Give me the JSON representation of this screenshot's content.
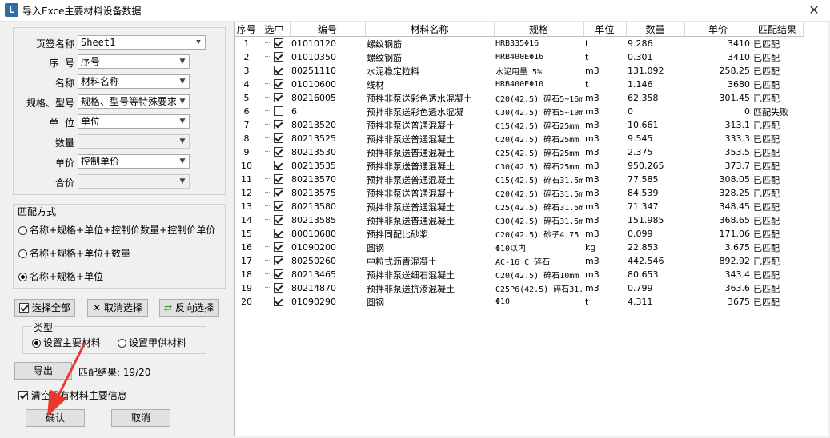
{
  "window": {
    "title": "导入Exce主要材料设备数据",
    "close_glyph": "✕"
  },
  "mapping": {
    "fields": [
      {
        "label": "页签名称",
        "value": "Sheet1",
        "enabled": true
      },
      {
        "label": "序  号",
        "value": "序号",
        "enabled": true
      },
      {
        "label": "名称",
        "value": "材料名称",
        "enabled": true
      },
      {
        "label": "规格、型号",
        "value": "规格、型号等特殊要求",
        "enabled": true
      },
      {
        "label": "单  位",
        "value": "单位",
        "enabled": true
      },
      {
        "label": "数量",
        "value": "",
        "enabled": false
      },
      {
        "label": "单价",
        "value": "控制单价",
        "enabled": true
      },
      {
        "label": "合价",
        "value": "",
        "enabled": false
      }
    ]
  },
  "match_mode": {
    "title": "匹配方式",
    "options": [
      {
        "label": "名称+规格+单位+控制价数量+控制价单价",
        "selected": false
      },
      {
        "label": "名称+规格+单位+数量",
        "selected": false
      },
      {
        "label": "名称+规格+单位",
        "selected": true
      }
    ]
  },
  "selection": {
    "select_all": "选择全部",
    "deselect": "取消选择",
    "invert": "反向选择"
  },
  "type_group": {
    "title": "类型",
    "main": "设置主要材料",
    "supply": "设置甲供材料",
    "selected": "main"
  },
  "export_label": "导出",
  "match_result": "匹配结果: 19/20",
  "clear_info": "清空已有材料主要信息",
  "confirm_label": "确认",
  "cancel_label": "取消",
  "table": {
    "columns": [
      "序号",
      "选中",
      "编号",
      "材料名称",
      "规格",
      "单位",
      "数量",
      "单价",
      "匹配结果"
    ],
    "rows": [
      {
        "no": "1",
        "checked": true,
        "code": "01010120",
        "name": "螺纹钢筋",
        "spec": "HRB335Φ16",
        "unit": "t",
        "qty": "9.286",
        "price": "3410",
        "result": "已匹配"
      },
      {
        "no": "2",
        "checked": true,
        "code": "01010350",
        "name": "螺纹钢筋",
        "spec": "HRB400EΦ16",
        "unit": "t",
        "qty": "0.301",
        "price": "3410",
        "result": "已匹配"
      },
      {
        "no": "3",
        "checked": true,
        "code": "80251110",
        "name": "水泥稳定粒料",
        "spec": "水泥用量 5%",
        "unit": "m3",
        "qty": "131.092",
        "price": "258.25",
        "result": "已匹配"
      },
      {
        "no": "4",
        "checked": true,
        "code": "01010600",
        "name": "线材",
        "spec": "HRB400EΦ10",
        "unit": "t",
        "qty": "1.146",
        "price": "3680",
        "result": "已匹配"
      },
      {
        "no": "5",
        "checked": true,
        "code": "80216005",
        "name": "预拌非泵送彩色透水混凝土",
        "spec": "C20(42.5) 碎石5~16mm",
        "unit": "m3",
        "qty": "62.358",
        "price": "301.45",
        "result": "已匹配"
      },
      {
        "no": "6",
        "checked": false,
        "code": "6",
        "name": "预拌非泵送彩色透水混凝",
        "spec": "C30(42.5) 碎石5~10mm",
        "unit": "m3",
        "qty": "0",
        "price": "0",
        "result": "匹配失败"
      },
      {
        "no": "7",
        "checked": true,
        "code": "80213520",
        "name": "预拌非泵送普通混凝土",
        "spec": "C15(42.5) 碎石25mm",
        "unit": "m3",
        "qty": "10.661",
        "price": "313.1",
        "result": "已匹配"
      },
      {
        "no": "8",
        "checked": true,
        "code": "80213525",
        "name": "预拌非泵送普通混凝土",
        "spec": "C20(42.5) 碎石25mm",
        "unit": "m3",
        "qty": "9.545",
        "price": "333.3",
        "result": "已匹配"
      },
      {
        "no": "9",
        "checked": true,
        "code": "80213530",
        "name": "预拌非泵送普通混凝土",
        "spec": "C25(42.5) 碎石25mm",
        "unit": "m3",
        "qty": "2.375",
        "price": "353.5",
        "result": "已匹配"
      },
      {
        "no": "10",
        "checked": true,
        "code": "80213535",
        "name": "预拌非泵送普通混凝土",
        "spec": "C30(42.5) 碎石25mm",
        "unit": "m3",
        "qty": "950.265",
        "price": "373.7",
        "result": "已匹配"
      },
      {
        "no": "11",
        "checked": true,
        "code": "80213570",
        "name": "预拌非泵送普通混凝土",
        "spec": "C15(42.5) 碎石31.5mm",
        "unit": "m3",
        "qty": "77.585",
        "price": "308.05",
        "result": "已匹配"
      },
      {
        "no": "12",
        "checked": true,
        "code": "80213575",
        "name": "预拌非泵送普通混凝土",
        "spec": "C20(42.5) 碎石31.5mm",
        "unit": "m3",
        "qty": "84.539",
        "price": "328.25",
        "result": "已匹配"
      },
      {
        "no": "13",
        "checked": true,
        "code": "80213580",
        "name": "预拌非泵送普通混凝土",
        "spec": "C25(42.5) 碎石31.5mm",
        "unit": "m3",
        "qty": "71.347",
        "price": "348.45",
        "result": "已匹配"
      },
      {
        "no": "14",
        "checked": true,
        "code": "80213585",
        "name": "预拌非泵送普通混凝土",
        "spec": "C30(42.5) 碎石31.5mm",
        "unit": "m3",
        "qty": "151.985",
        "price": "368.65",
        "result": "已匹配"
      },
      {
        "no": "15",
        "checked": true,
        "code": "80010680",
        "name": "预拌同配比砂浆",
        "spec": "C20(42.5) 砂子4.75",
        "unit": "m3",
        "qty": "0.099",
        "price": "171.06",
        "result": "已匹配"
      },
      {
        "no": "16",
        "checked": true,
        "code": "01090200",
        "name": "圆钢",
        "spec": "Φ10以内",
        "unit": "kg",
        "qty": "22.853",
        "price": "3.675",
        "result": "已匹配"
      },
      {
        "no": "17",
        "checked": true,
        "code": "80250260",
        "name": "中粒式沥青混凝土",
        "spec": "AC-16 C 碎石",
        "unit": "m3",
        "qty": "442.546",
        "price": "892.92",
        "result": "已匹配"
      },
      {
        "no": "18",
        "checked": true,
        "code": "80213465",
        "name": "预拌非泵送细石混凝土",
        "spec": "C20(42.5) 碎石10mm",
        "unit": "m3",
        "qty": "80.653",
        "price": "343.4",
        "result": "已匹配"
      },
      {
        "no": "19",
        "checked": true,
        "code": "80214870",
        "name": "预拌非泵送抗渗混凝土",
        "spec": "C25P6(42.5) 碎石31.",
        "unit": "m3",
        "qty": "0.799",
        "price": "363.6",
        "result": "已匹配"
      },
      {
        "no": "20",
        "checked": true,
        "code": "01090290",
        "name": "圆钢",
        "spec": "Φ10",
        "unit": "t",
        "qty": "4.311",
        "price": "3675",
        "result": "已匹配"
      }
    ]
  },
  "colors": {
    "accent": "#e8392f",
    "app_icon": "#2e6da4"
  }
}
